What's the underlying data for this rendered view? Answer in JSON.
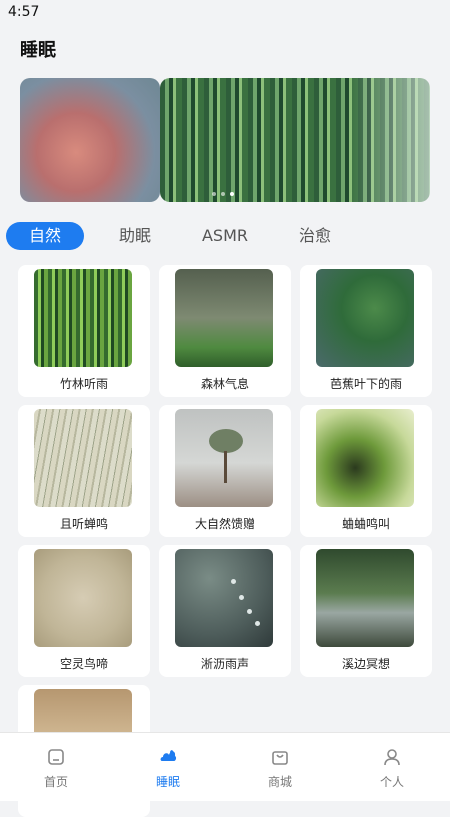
{
  "status": {
    "time": "4:57"
  },
  "header": {
    "title": "睡眠"
  },
  "banner": {
    "active_index": 2
  },
  "tabs": [
    {
      "label": "自然"
    },
    {
      "label": "助眠"
    },
    {
      "label": "ASMR"
    },
    {
      "label": "治愈"
    }
  ],
  "items": [
    {
      "label": "竹林听雨"
    },
    {
      "label": "森林气息"
    },
    {
      "label": "芭蕉叶下的雨"
    },
    {
      "label": "且听蝉鸣"
    },
    {
      "label": "大自然馈赠"
    },
    {
      "label": "蛐蛐鸣叫"
    },
    {
      "label": "空灵鸟啼"
    },
    {
      "label": "淅沥雨声"
    },
    {
      "label": "溪边冥想"
    },
    {
      "label": ""
    }
  ],
  "nav": [
    {
      "label": "首页"
    },
    {
      "label": "睡眠"
    },
    {
      "label": "商城"
    },
    {
      "label": "个人"
    }
  ],
  "colors": {
    "accent": "#1e7cf0",
    "background": "#f2f3f5"
  }
}
